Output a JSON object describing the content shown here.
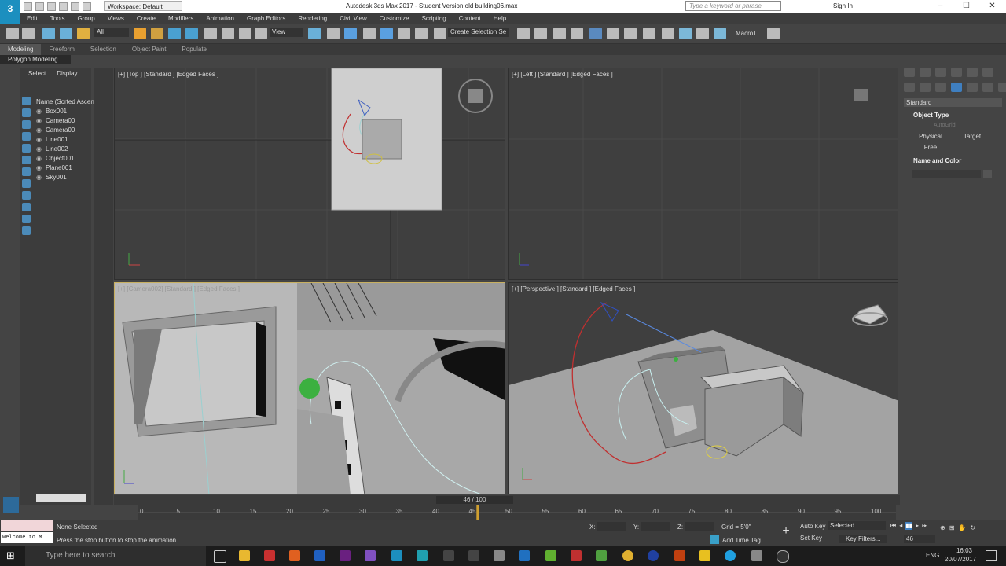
{
  "titlebar": {
    "workspace": "Workspace: Default",
    "title": "Autodesk 3ds Max 2017 - Student Version    old building06.max",
    "search_placeholder": "Type a keyword or phrase",
    "signin": "Sign In"
  },
  "menu": [
    "Edit",
    "Tools",
    "Group",
    "Views",
    "Create",
    "Modifiers",
    "Animation",
    "Graph Editors",
    "Rendering",
    "Civil View",
    "Customize",
    "Scripting",
    "Content",
    "Help"
  ],
  "toolbar": {
    "filter": "All",
    "refcoord": "View",
    "selection_set": "Create Selection Se",
    "macro": "Macro1"
  },
  "ribbon": {
    "tabs": [
      "Modeling",
      "Freeform",
      "Selection",
      "Object Paint",
      "Populate"
    ],
    "sub": "Polygon Modeling"
  },
  "scene_explorer": {
    "tabs": [
      "Select",
      "Display"
    ],
    "header": "Name (Sorted Ascen",
    "items": [
      "Box001",
      "Camera00",
      "Camera00",
      "Line001",
      "Line002",
      "Object001",
      "Plane001",
      "Sky001"
    ]
  },
  "viewports": {
    "top": "[+] [Top ] [Standard ] [Edged Faces ]",
    "left": "[+] [Left ] [Standard ] [Edged Faces ]",
    "camera": "[+] [Camera002] [Standard ] [Edged Faces ]",
    "perspective": "[+] [Perspective ] [Standard ] [Edged Faces ]"
  },
  "command_panel": {
    "dropdown": "Standard",
    "object_type_title": "Object Type",
    "autogrid": "AutoGrid",
    "buttons": [
      "Physical",
      "Target",
      "Free"
    ],
    "name_color_title": "Name and Color"
  },
  "timeline": {
    "frame": "46 / 100",
    "current_frame_fraction": 0.46,
    "ticks": [
      "0",
      "5",
      "10",
      "15",
      "20",
      "25",
      "30",
      "35",
      "40",
      "45",
      "50",
      "55",
      "60",
      "65",
      "70",
      "75",
      "80",
      "85",
      "90",
      "95",
      "100"
    ]
  },
  "status": {
    "selection": "None Selected",
    "prompt": "Press the stop button to stop the animation",
    "maxscript": "Welcome to M",
    "x_label": "X:",
    "y_label": "Y:",
    "z_label": "Z:",
    "grid": "Grid = 5'0\"",
    "add_time_tag": "Add Time Tag",
    "auto_key": "Auto Key",
    "set_key": "Set Key",
    "key_mode": "Selected",
    "key_filters": "Key Filters...",
    "frame_input": "46"
  },
  "taskbar": {
    "search": "Type here to search",
    "lang": "ENG",
    "time": "16:03",
    "date": "20/07/2017"
  }
}
